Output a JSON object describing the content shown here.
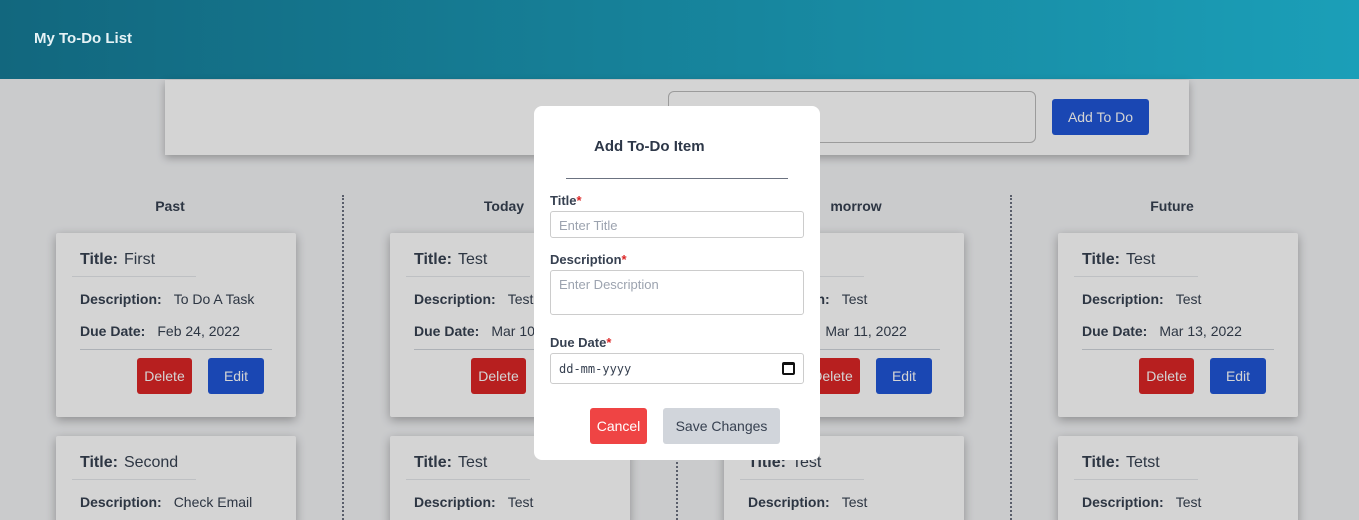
{
  "app": {
    "title": "My To-Do List"
  },
  "add_panel": {
    "button": "Add To Do"
  },
  "labels": {
    "title": "Title:",
    "description": "Description:",
    "due_date": "Due Date:",
    "delete": "Delete",
    "edit": "Edit"
  },
  "columns": [
    {
      "heading": "Past",
      "cards": [
        {
          "title": "First",
          "description": "To Do A Task",
          "due": "Feb 24, 2022"
        },
        {
          "title": "Second",
          "description": "Check Email"
        }
      ]
    },
    {
      "heading": "Today",
      "cards": [
        {
          "title": "Test",
          "description": "Test",
          "due": "Mar 10,"
        },
        {
          "title": "Test",
          "description": "Test"
        }
      ]
    },
    {
      "heading": "morrow",
      "cards": [
        {
          "title": "",
          "description": "Test",
          "due": "Mar 11, 2022"
        },
        {
          "title": "Test",
          "description": "Test"
        }
      ]
    },
    {
      "heading": "Future",
      "cards": [
        {
          "title": "Test",
          "description": "Test",
          "due": "Mar 13, 2022"
        },
        {
          "title": "Tetst",
          "description": "Test"
        }
      ]
    }
  ],
  "modal": {
    "heading": "Add To-Do Item",
    "title_label": "Title",
    "title_placeholder": "Enter Title",
    "description_label": "Description",
    "description_placeholder": "Enter Description",
    "due_label": "Due Date",
    "due_value": "dd-mm-yyyy",
    "required_mark": "*",
    "cancel": "Cancel",
    "save": "Save Changes"
  },
  "colors": {
    "nav_start": "#12677e",
    "nav_end": "#1b9fb8",
    "primary": "#2056d8",
    "danger": "#dc2626"
  }
}
